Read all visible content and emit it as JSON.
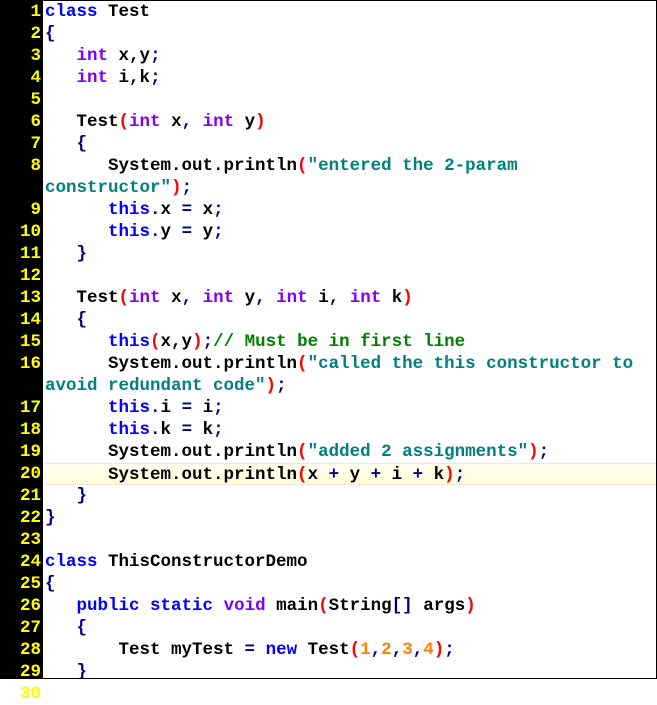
{
  "gutter": [
    "1",
    "2",
    "3",
    "4",
    "5",
    "6",
    "7",
    "8",
    "9",
    "10",
    "11",
    "12",
    "13",
    "14",
    "15",
    "16",
    "17",
    "18",
    "19",
    "20",
    "21",
    "22",
    "23",
    "24",
    "25",
    "26",
    "27",
    "28",
    "29",
    "30"
  ],
  "code": {
    "l1": {
      "kw": "class",
      "sp": " ",
      "id": "Test"
    },
    "l2": {
      "brace": "{"
    },
    "l3": {
      "indent": "   ",
      "type": "int",
      "sp": " ",
      "ids": "x,y",
      "semi": ";"
    },
    "l4": {
      "indent": "   ",
      "type": "int",
      "sp": " ",
      "ids": "i,k",
      "semi": ";"
    },
    "l5": {
      "blank": ""
    },
    "l6": {
      "indent": "   ",
      "id": "Test",
      "open": "(",
      "type1": "int",
      "sp1": " ",
      "p1": "x",
      "comma": ", ",
      "type2": "int",
      "sp2": " ",
      "p2": "y",
      "close": ")"
    },
    "l7": {
      "indent": "   ",
      "brace": "{"
    },
    "l8": {
      "indent": "      ",
      "expr": "System.out.println",
      "open": "(",
      "str": "\"entered the 2-param constructor\"",
      "close": ")",
      "semi": ";"
    },
    "l9": {
      "indent": "      ",
      "this": "this",
      "dot": ".",
      "id": "x ",
      "eq": "=",
      "sp": " ",
      "rhs": "x",
      "semi": ";"
    },
    "l10": {
      "indent": "      ",
      "this": "this",
      "dot": ".",
      "id": "y ",
      "eq": "=",
      "sp": " ",
      "rhs": "y",
      "semi": ";"
    },
    "l11": {
      "indent": "   ",
      "brace": "}"
    },
    "l12": {
      "blank": ""
    },
    "l13": {
      "indent": "   ",
      "id": "Test",
      "open": "(",
      "type1": "int",
      "sp1": " ",
      "p1": "x",
      "c1": ", ",
      "type2": "int",
      "sp2": " ",
      "p2": "y",
      "c2": ", ",
      "type3": "int",
      "sp3": " ",
      "p3": "i",
      "c3": ", ",
      "type4": "int",
      "sp4": " ",
      "p4": "k",
      "close": ")"
    },
    "l14": {
      "indent": "   ",
      "brace": "{"
    },
    "l15": {
      "indent": "      ",
      "this": "this",
      "open": "(",
      "args": "x,y",
      "close": ")",
      "semi": ";",
      "cmt": "// Must be in first line"
    },
    "l16": {
      "indent": "      ",
      "expr": "System.out.println",
      "open": "(",
      "str": "\"called the this constructor to avoid redundant code\"",
      "close": ")",
      "semi": ";"
    },
    "l17": {
      "indent": "      ",
      "this": "this",
      "dot": ".",
      "id": "i ",
      "eq": "=",
      "sp": " ",
      "rhs": "i",
      "semi": ";"
    },
    "l18": {
      "indent": "      ",
      "this": "this",
      "dot": ".",
      "id": "k ",
      "eq": "=",
      "sp": " ",
      "rhs": "k",
      "semi": ";"
    },
    "l19": {
      "indent": "      ",
      "expr": "System.out.println",
      "open": "(",
      "str": "\"added 2 assignments\"",
      "close": ")",
      "semi": ";"
    },
    "l20": {
      "indent": "      ",
      "expr": "System.out.println",
      "open": "(",
      "a": "x ",
      "p1": "+",
      "b": " y ",
      "p2": "+",
      "c": " i ",
      "p3": "+",
      "d": " k",
      "close": ")",
      "semi": ";"
    },
    "l21": {
      "indent": "   ",
      "brace": "}"
    },
    "l22": {
      "brace": "}"
    },
    "l23": {
      "blank": ""
    },
    "l24": {
      "kw": "class",
      "sp": " ",
      "id": "ThisConstructorDemo"
    },
    "l25": {
      "brace": "{"
    },
    "l26": {
      "indent": "   ",
      "kw1": "public",
      "sp1": " ",
      "kw2": "static",
      "sp2": " ",
      "type": "void",
      "sp3": " ",
      "id": "main",
      "open": "(",
      "ptype": "String",
      "arr": "[]",
      "sp4": " ",
      "pname": "args",
      "close": ")"
    },
    "l27": {
      "indent": "   ",
      "brace": "{"
    },
    "l28": {
      "indent": "       ",
      "id1": "Test myTest ",
      "eq": "=",
      "sp": " ",
      "kw": "new",
      "sp2": " ",
      "id2": "Test",
      "open": "(",
      "n1": "1",
      "c1": ",",
      "n2": "2",
      "c2": ",",
      "n3": "3",
      "c3": ",",
      "n4": "4",
      "close": ")",
      "semi": ";"
    },
    "l29": {
      "indent": "   ",
      "brace": "}"
    },
    "l30": {
      "brace": "}"
    }
  }
}
